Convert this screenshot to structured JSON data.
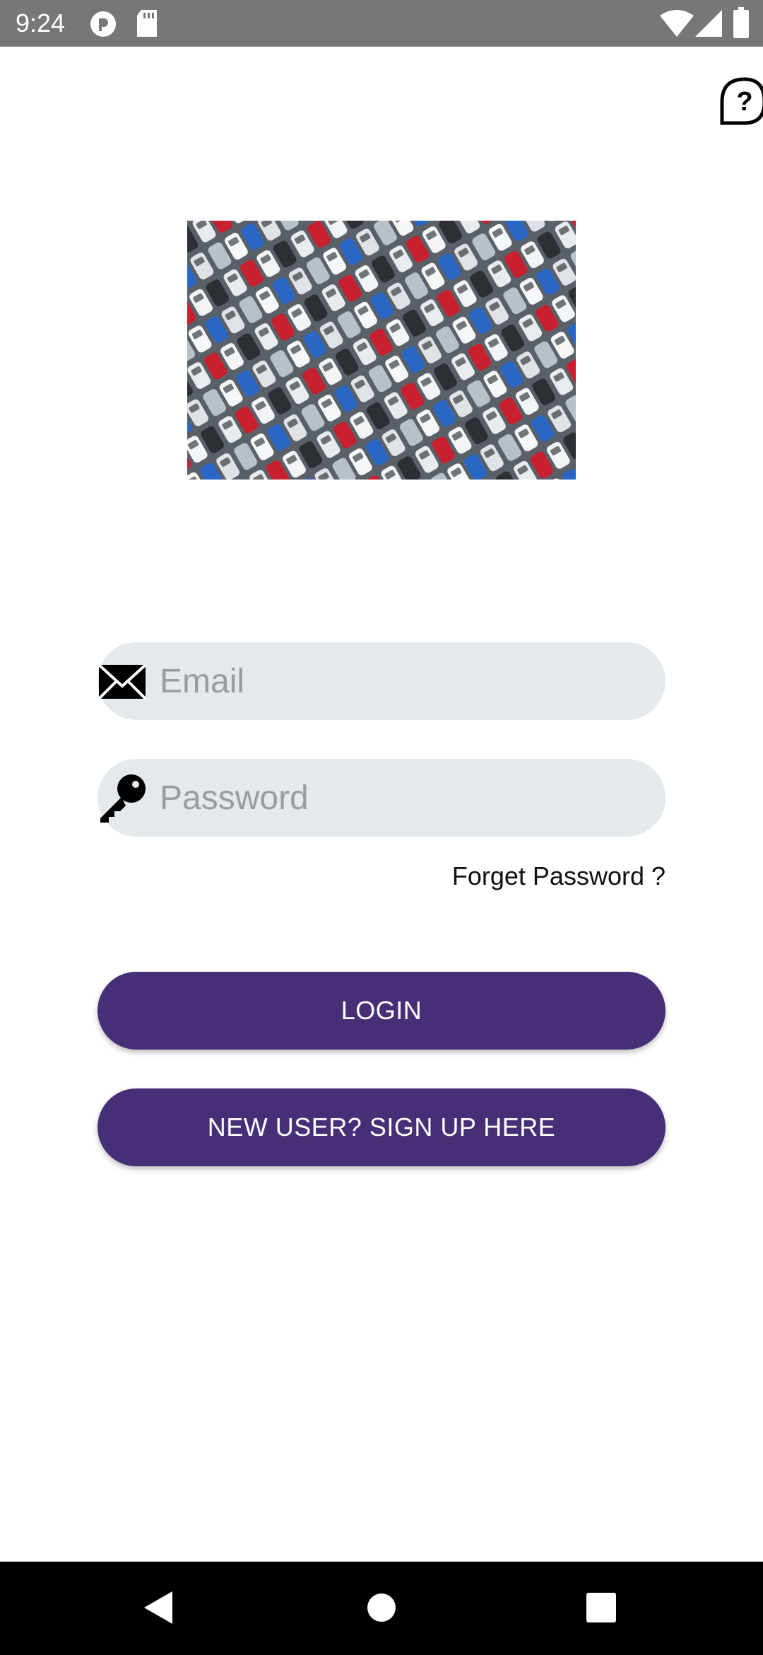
{
  "status_bar": {
    "time": "9:24",
    "icons": [
      "pocket-casts-icon",
      "sd-card-icon",
      "wifi-icon",
      "cellular-signal-icon",
      "battery-icon"
    ]
  },
  "header": {
    "help_icon": "help-question-icon",
    "help_glyph": "?"
  },
  "hero": {
    "image": "parking-lot-cars-photo"
  },
  "login_form": {
    "email": {
      "placeholder": "Email",
      "value": "",
      "icon": "envelope-icon"
    },
    "password": {
      "placeholder": "Password",
      "value": "",
      "icon": "key-icon"
    },
    "forgot_password": "Forget Password ?",
    "login_button": "LOGIN",
    "signup_button": "NEW USER? SIGN UP HERE"
  },
  "colors": {
    "primary": "#472f77",
    "input_background": "#e5e9ec",
    "status_bar": "#777777",
    "nav_bar": "#000000"
  },
  "nav_bar": {
    "icons": [
      "back-icon",
      "home-icon",
      "recents-icon"
    ]
  }
}
